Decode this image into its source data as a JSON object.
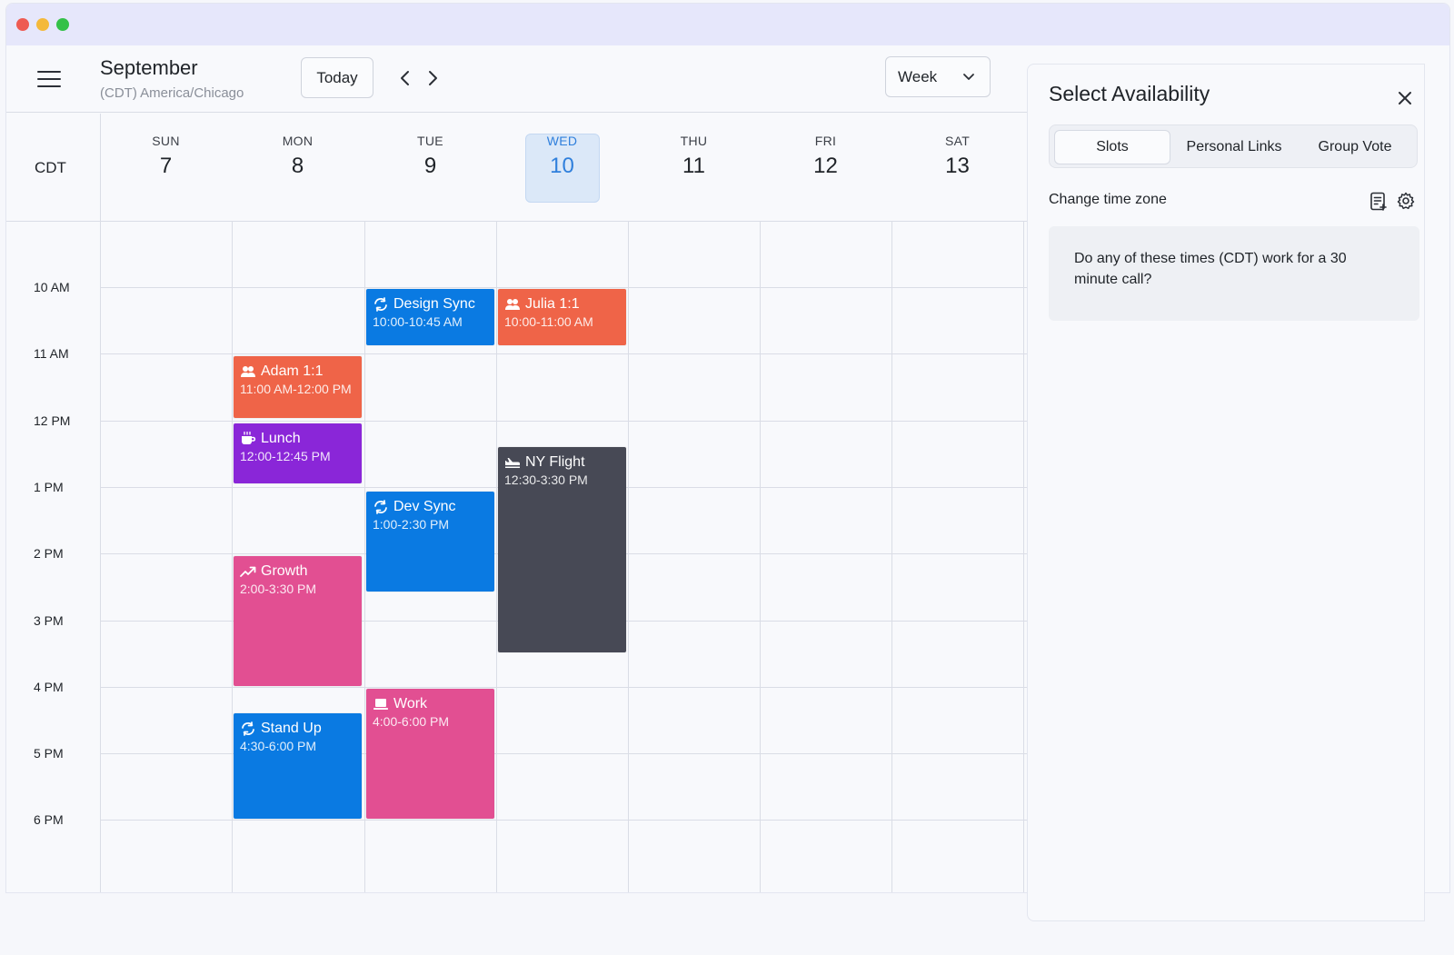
{
  "header": {
    "month": "September",
    "timezone": "(CDT) America/Chicago",
    "today_label": "Today",
    "view_select": "Week"
  },
  "grid": {
    "tz_label": "CDT",
    "days": [
      {
        "name": "SUN",
        "num": "7"
      },
      {
        "name": "MON",
        "num": "8"
      },
      {
        "name": "TUE",
        "num": "9"
      },
      {
        "name": "WED",
        "num": "10"
      },
      {
        "name": "THU",
        "num": "11"
      },
      {
        "name": "FRI",
        "num": "12"
      },
      {
        "name": "SAT",
        "num": "13"
      }
    ],
    "active_day": "WED",
    "times": [
      "10 AM",
      "11 AM",
      "12 PM",
      "1 PM",
      "2 PM",
      "3 PM",
      "4 PM",
      "5 PM",
      "6 PM"
    ]
  },
  "events": [
    {
      "title": "Design Sync",
      "time": "10:00-10:45 AM",
      "icon": "recurring-icon",
      "color": "#0a7ae2"
    },
    {
      "title": "Julia 1:1",
      "time": "10:00-11:00 AM",
      "icon": "people-icon",
      "color": "#ef6448"
    },
    {
      "title": "Adam 1:1",
      "time": "11:00 AM-12:00 PM",
      "icon": "people-icon",
      "color": "#ef6448"
    },
    {
      "title": "Lunch",
      "time": "12:00-12:45 PM",
      "icon": "coffee-icon",
      "color": "#8a26d8"
    },
    {
      "title": "NY Flight",
      "time": "12:30-3:30 PM",
      "icon": "plane-icon",
      "color": "#474955"
    },
    {
      "title": "Dev Sync",
      "time": "1:00-2:30 PM",
      "icon": "recurring-icon",
      "color": "#0a7ae2"
    },
    {
      "title": "Growth",
      "time": "2:00-3:30 PM",
      "icon": "trend-up-icon",
      "color": "#e24f92"
    },
    {
      "title": "Work",
      "time": "4:00-6:00 PM",
      "icon": "laptop-icon",
      "color": "#e24f92"
    },
    {
      "title": "Stand Up",
      "time": "4:30-6:00 PM",
      "icon": "recurring-icon",
      "color": "#0a7ae2"
    }
  ],
  "panel": {
    "title": "Select Availability",
    "tabs": [
      {
        "label": "Slots",
        "active": true
      },
      {
        "label": "Personal Links",
        "active": false
      },
      {
        "label": "Group Vote",
        "active": false
      }
    ],
    "change_tz": "Change time zone",
    "message": "Do any of these times (CDT) work for a 30 minute call?"
  }
}
